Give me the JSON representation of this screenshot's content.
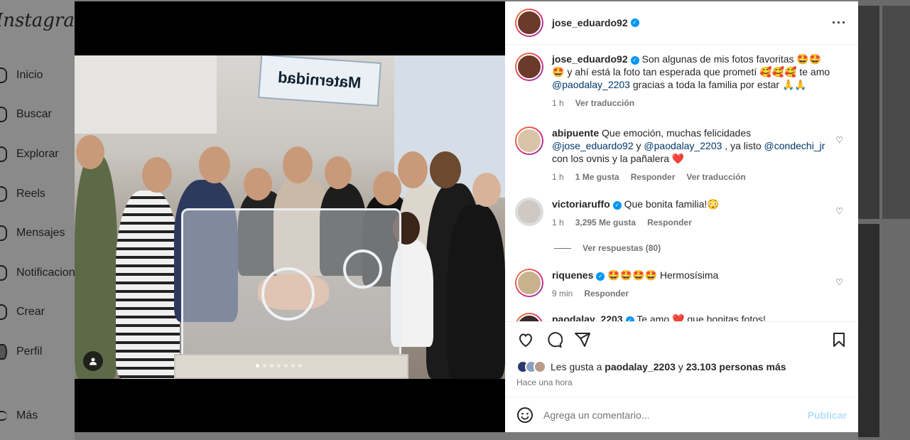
{
  "sidebar": {
    "logo": "Instagram",
    "items": [
      {
        "label": "Inicio",
        "icon": "home-icon"
      },
      {
        "label": "Buscar",
        "icon": "search-icon"
      },
      {
        "label": "Explorar",
        "icon": "compass-icon"
      },
      {
        "label": "Reels",
        "icon": "reels-icon"
      },
      {
        "label": "Mensajes",
        "icon": "messenger-icon"
      },
      {
        "label": "Notificaciones",
        "icon": "heart-icon"
      },
      {
        "label": "Crear",
        "icon": "plus-icon"
      },
      {
        "label": "Perfil",
        "icon": "profile-icon"
      },
      {
        "label": "Más",
        "icon": "menu-icon"
      }
    ]
  },
  "media": {
    "sign_text": "Maternidad"
  },
  "post": {
    "author": "jose_eduardo92",
    "caption": {
      "user": "jose_eduardo92",
      "text_1": "Son algunas de mis fotos favoritas 🤩🤩🤩 y ahí está la foto tan esperada que prometí 🥰🥰🥰 te amo ",
      "mention": "@paodalay_2203",
      "text_2": " gracias a toda la familia por estar 🙏🙏",
      "time": "1 h",
      "translate": "Ver traducción"
    },
    "comments": [
      {
        "user": "abipuente",
        "text_1": "Que emoción, muchas felicidades ",
        "mention_1": "@jose_eduardo92",
        "text_2": " y ",
        "mention_2": "@paodalay_2203",
        "text_3": " , ya listo ",
        "mention_3": "@condechi_jr",
        "text_4": " con los ovnis y la pañalera ❤️",
        "time": "1 h",
        "likes": "1 Me gusta",
        "reply": "Responder",
        "translate": "Ver traducción"
      },
      {
        "user": "victoriaruffo",
        "text": "Que bonita familia!😳",
        "time": "1 h",
        "likes": "3,295 Me gusta",
        "reply": "Responder",
        "view_replies": "Ver respuestas (80)"
      },
      {
        "user": "riquenes",
        "text": "🤩🤩🤩🤩 Hermosísima",
        "time": "9 min",
        "reply": "Responder"
      },
      {
        "user": "paodalay_2203",
        "text": "Te amo ❤️ que bonitas fotos!"
      }
    ],
    "likes_prefix": "Les gusta a ",
    "likes_user": "paodalay_2203",
    "likes_middle": " y ",
    "likes_count": "23.103 personas más",
    "time_ago": "Hace una hora"
  },
  "comment_box": {
    "placeholder": "Agrega un comentario...",
    "publish": "Publicar"
  }
}
